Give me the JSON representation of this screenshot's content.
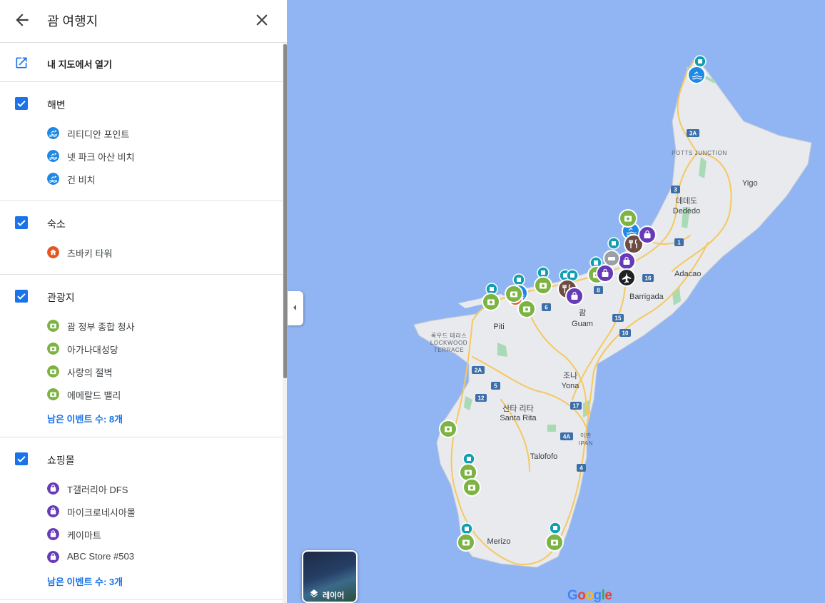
{
  "header": {
    "title": "괌 여행지"
  },
  "open_in_my_maps": "내 지도에서 열기",
  "sections": [
    {
      "title": "해변",
      "color": "#1e88e5",
      "items": [
        "리티디안 포인트",
        "넷 파크 아산 비치",
        "건 비치"
      ],
      "more": ""
    },
    {
      "title": "숙소",
      "color": "#e8541e",
      "items": [
        "츠바키 타워"
      ],
      "more": ""
    },
    {
      "title": "관광지",
      "color": "#7cb342",
      "items": [
        "괌 정부 종합 청사",
        "아가나대성당",
        "사랑의 절벽",
        "에메랄드 밸리"
      ],
      "more": "남은 이벤트 수: 8개"
    },
    {
      "title": "쇼핑몰",
      "color": "#673ab7",
      "items": [
        "T갤러리아 DFS",
        "마이크로네시아몰",
        "케이마트",
        "ABC Store #503"
      ],
      "more": "남은 이벤트 수: 3개"
    }
  ],
  "map": {
    "layers_label": "레이어",
    "logo": "Google",
    "places": {
      "yigo": "Yigo",
      "dededo_ko": "데데도",
      "dededo": "Dededo",
      "potts_junction": "POTTS JUNCTION",
      "adacao": "Adacao",
      "barrigada": "Barrigada",
      "piti": "Piti",
      "guam_ko": "괌",
      "guam": "Guam",
      "lockwood_ko": "록우드 테라스",
      "lockwood_1": "LOCKWOOD",
      "lockwood_2": "TERRACE",
      "yona_ko": "조나",
      "yona": "Yona",
      "santarita_ko": "산타 리타",
      "santarita": "Santa Rita",
      "ipan_ko": "이판",
      "ipan": "IPAN",
      "talofofo": "Talofofo",
      "merizo": "Merizo"
    },
    "route_shields": [
      "3A",
      "3",
      "1",
      "16",
      "8",
      "6",
      "15",
      "10",
      "2A",
      "5",
      "12",
      "17",
      "4A",
      "4"
    ],
    "colors": {
      "water": "#91b5f2",
      "land": "#e8eaed",
      "road": "#f6c85f",
      "beach": "#1e88e5",
      "sight": "#7cb342",
      "shop": "#673ab7",
      "food": "#6d4c41",
      "hotel": "#e8541e",
      "pin": "#129eaf"
    }
  }
}
